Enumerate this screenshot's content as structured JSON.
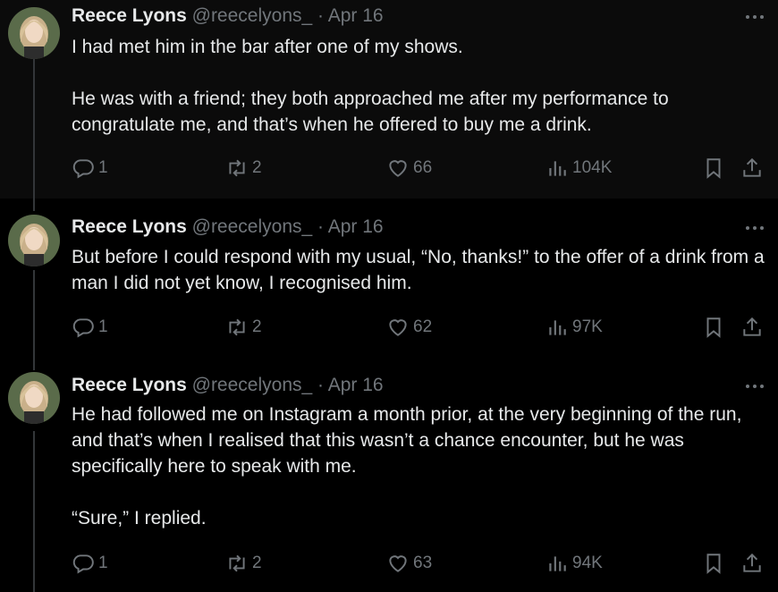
{
  "tweets": [
    {
      "name": "Reece Lyons",
      "handle": "@reecelyons_",
      "separator": "·",
      "date": "Apr 16",
      "paragraphs": [
        "I had met him in the bar after one of my shows.",
        "He was with a friend; they both approached me after my performance to congratulate me, and that’s when he offered to buy me a drink."
      ],
      "replies": "1",
      "reposts": "2",
      "likes": "66",
      "views": "104K"
    },
    {
      "name": "Reece Lyons",
      "handle": "@reecelyons_",
      "separator": "·",
      "date": "Apr 16",
      "paragraphs": [
        "But before I could respond with my usual, “No, thanks!” to the offer of a drink from a man I did not yet know, I recognised him."
      ],
      "replies": "1",
      "reposts": "2",
      "likes": "62",
      "views": "97K"
    },
    {
      "name": "Reece Lyons",
      "handle": "@reecelyons_",
      "separator": "·",
      "date": "Apr 16",
      "paragraphs": [
        "He had followed me on Instagram a month prior, at the very beginning of the run, and that’s when I realised that this wasn’t a chance encounter, but he was specifically here to speak with me.",
        "“Sure,” I replied."
      ],
      "replies": "1",
      "reposts": "2",
      "likes": "63",
      "views": "94K"
    }
  ],
  "icons": {
    "more": "more-horizontal-icon",
    "reply": "reply-bubble-icon",
    "repost": "repost-arrows-icon",
    "like": "heart-icon",
    "views": "views-bar-chart-icon",
    "bookmark": "bookmark-icon",
    "share": "share-upload-icon"
  },
  "colors": {
    "background": "#000000",
    "text": "#e7e9ea",
    "muted": "#71767b",
    "thread_line": "#333639"
  }
}
